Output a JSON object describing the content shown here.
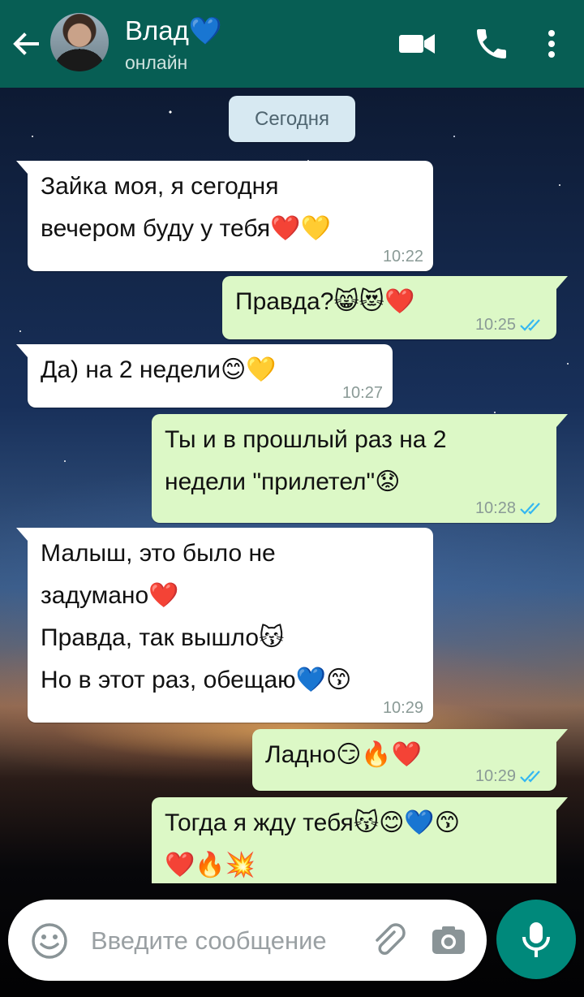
{
  "header": {
    "contact_name": "Влад💙",
    "status": "онлайн"
  },
  "chat": {
    "date_label": "Сегодня",
    "messages": [
      {
        "direction": "in",
        "lines": [
          "Зайка моя, я сегодня",
          "вечером буду у тебя❤️💛"
        ],
        "time": "10:22"
      },
      {
        "direction": "out",
        "lines": [
          "Правда?😸😻❤️"
        ],
        "time": "10:25",
        "read": true
      },
      {
        "direction": "in",
        "lines": [
          "Да) на 2 недели😊💛"
        ],
        "time": "10:27"
      },
      {
        "direction": "out",
        "lines": [
          "Ты и в прошлый раз на 2",
          "недели \"прилетел\"😟"
        ],
        "time": "10:28",
        "read": true
      },
      {
        "direction": "in",
        "lines": [
          "Малыш, это было не",
          "задумано❤️",
          "Правда, так вышло😽",
          "Но в этот раз, обещаю💙😙"
        ],
        "time": "10:29"
      },
      {
        "direction": "out",
        "lines": [
          "Ладно😏🔥❤️"
        ],
        "time": "10:29",
        "read": true
      },
      {
        "direction": "out",
        "lines": [
          "Тогда я жду тебя😽😊💙😙",
          "❤️🔥💥"
        ],
        "time": "",
        "read": false
      }
    ]
  },
  "composer": {
    "placeholder": "Введите сообщение"
  },
  "colors": {
    "header": "#075e54",
    "outgoing_bubble": "#dcf8c6",
    "incoming_bubble": "#ffffff",
    "read_ticks": "#34b7f1",
    "mic_button": "#00897b"
  },
  "icons": [
    "back-arrow-icon",
    "video-call-icon",
    "phone-icon",
    "more-vert-icon",
    "emoji-icon",
    "paperclip-icon",
    "camera-icon",
    "mic-icon",
    "double-check-icon"
  ]
}
